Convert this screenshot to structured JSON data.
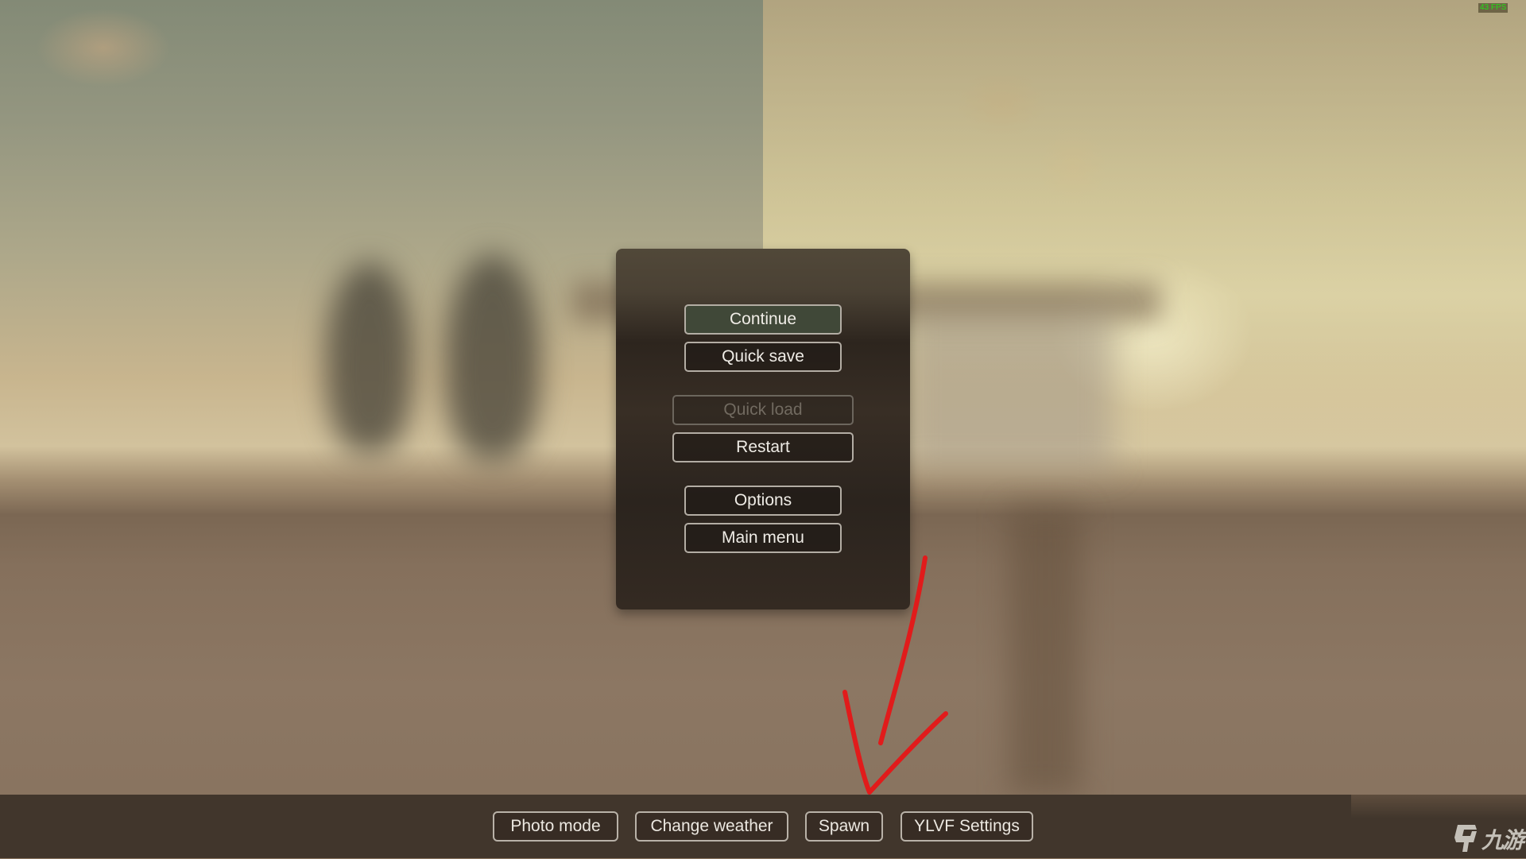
{
  "hud": {
    "fps_counter": "43 FPS",
    "fps_color": "#22e015"
  },
  "pause_menu": {
    "buttons": [
      {
        "id": "continue",
        "label": "Continue",
        "state": "highlighted"
      },
      {
        "id": "quick-save",
        "label": "Quick save",
        "state": "enabled"
      },
      {
        "id": "quick-load",
        "label": "Quick load",
        "state": "disabled"
      },
      {
        "id": "restart",
        "label": "Restart",
        "state": "enabled"
      },
      {
        "id": "options",
        "label": "Options",
        "state": "enabled"
      },
      {
        "id": "main-menu",
        "label": "Main menu",
        "state": "enabled"
      }
    ]
  },
  "bottom_bar": {
    "buttons": [
      {
        "id": "photo-mode",
        "label": "Photo mode"
      },
      {
        "id": "change-weather",
        "label": "Change weather"
      },
      {
        "id": "spawn",
        "label": "Spawn"
      },
      {
        "id": "ylvf-settings",
        "label": "YLVF Settings"
      }
    ]
  },
  "annotation": {
    "type": "red-hand-drawn-arrow",
    "points_to": "Spawn",
    "color": "#e11b1b"
  },
  "watermark": {
    "icon": "jiuyou-logo-icon",
    "text": "九游"
  },
  "colors": {
    "panel_bg": "#2d251e",
    "button_border": "#b3ada4",
    "highlight_bg": "#404838",
    "bar_bg": "#41362c"
  }
}
